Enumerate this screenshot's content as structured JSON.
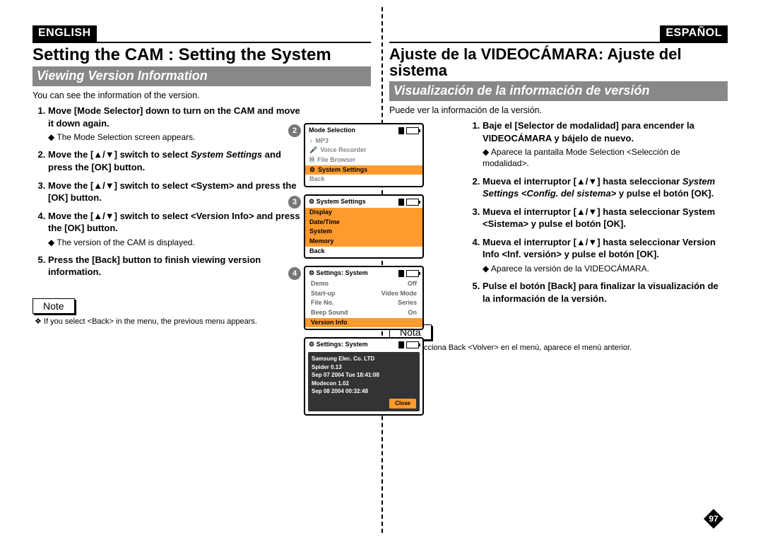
{
  "langs": {
    "en": "ENGLISH",
    "es": "ESPAÑOL"
  },
  "page_number": "97",
  "en": {
    "title": "Setting the CAM : Setting the System",
    "section": "Viewing Version Information",
    "intro": "You can see the information of the version.",
    "step1": "Move [Mode Selector] down to turn on the CAM and move it down again.",
    "step1_sub": "The Mode Selection screen appears.",
    "step2_a": "Move the [▲/▼] switch to select ",
    "step2_b": "System Settings",
    "step2_c": " and press the [OK] button.",
    "step3": "Move the [▲/▼] switch to select <System> and press the [OK] button.",
    "step4": "Move the [▲/▼] switch to select <Version Info> and press the [OK] button.",
    "step4_sub": "The version of the CAM is displayed.",
    "step5": "Press the [Back] button to finish viewing version information.",
    "note_label": "Note",
    "note": "If you select <Back> in the menu, the previous menu appears."
  },
  "es": {
    "title": "Ajuste de la VIDEOCÁMARA: Ajuste del sistema",
    "section": "Visualización de la información de versión",
    "intro": "Puede ver la información de la versión.",
    "step1": "Baje el [Selector de modalidad] para encender la VIDEOCÁMARA y bájelo de nuevo.",
    "step1_sub": "Aparece la pantalla Mode Selection <Selección de modalidad>.",
    "step2_a": "Mueva el interruptor [▲/▼] hasta seleccionar ",
    "step2_b": "System Settings <Config. del sistema>",
    "step2_c": " y pulse el botón [OK].",
    "step3": "Mueva el interruptor [▲/▼] hasta seleccionar System <Sistema> y pulse el botón [OK].",
    "step4": "Mueva el interruptor [▲/▼] hasta seleccionar Version Info <Inf. versión> y pulse el botón [OK].",
    "step4_sub": "Aparece la versión de la VIDEOCÁMARA.",
    "step5": "Pulse el botón [Back] para finalizar la visualización de la información de la versión.",
    "note_label": "Nota",
    "note": "Si selecciona Back <Volver> en el menú, aparece el menú anterior."
  },
  "screens": {
    "s2": {
      "title": "Mode Selection",
      "items": [
        "MP3",
        "Voice Recorder",
        "File Browser",
        "System Settings",
        "Back"
      ],
      "selected_index": 3
    },
    "s3": {
      "title": "System Settings",
      "items": [
        "Display",
        "Date/Time",
        "System",
        "Memory",
        "Back"
      ],
      "selected_index": 2
    },
    "s4": {
      "title": "Settings: System",
      "kv": [
        {
          "k": "Demo",
          "v": "Off"
        },
        {
          "k": "Start-up",
          "v": "Video Mode"
        },
        {
          "k": "File No.",
          "v": "Series"
        },
        {
          "k": "Beep Sound",
          "v": "On"
        },
        {
          "k": "Version Info",
          "v": ""
        }
      ],
      "selected_index": 4
    },
    "s5": {
      "title": "Settings: System",
      "lines": [
        "Samsung Elec. Co. LTD",
        "Spider 0.13",
        "Sep 07 2004 Tue 18:41:08",
        "Modecon 1.02",
        "Sep 08 2004 00:32:48"
      ],
      "close": "Close"
    },
    "step_nums": [
      "2",
      "3",
      "4"
    ]
  }
}
